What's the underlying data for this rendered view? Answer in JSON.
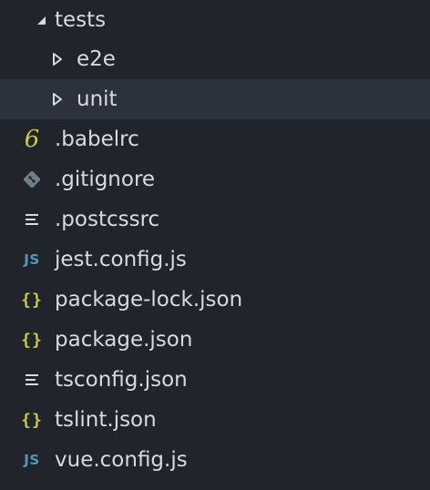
{
  "tree": [
    {
      "label": "tests",
      "icon": "caret-down-icon",
      "kind": "folder-open"
    },
    {
      "label": "e2e",
      "icon": "caret-right-icon",
      "kind": "folder-closed"
    },
    {
      "label": "unit",
      "icon": "caret-right-icon",
      "kind": "folder-closed",
      "hovered": true
    },
    {
      "label": ".babelrc",
      "icon": "babel-icon",
      "glyph": "6"
    },
    {
      "label": ".gitignore",
      "icon": "git-icon"
    },
    {
      "label": ".postcssrc",
      "icon": "lines-icon"
    },
    {
      "label": "jest.config.js",
      "icon": "js-icon",
      "glyph": "JS"
    },
    {
      "label": "package-lock.json",
      "icon": "json-icon",
      "glyph": "{}"
    },
    {
      "label": "package.json",
      "icon": "json-icon",
      "glyph": "{}"
    },
    {
      "label": "tsconfig.json",
      "icon": "lines-icon"
    },
    {
      "label": "tslint.json",
      "icon": "json-icon",
      "glyph": "{}"
    },
    {
      "label": "vue.config.js",
      "icon": "js-icon",
      "glyph": "JS"
    }
  ],
  "colors": {
    "background": "#21252b",
    "hover_background": "#2c313a",
    "text": "#d7dae0",
    "caret": "#d7dae0",
    "js_icon": "#519aba",
    "json_icon": "#cbcb41",
    "babel_icon": "#cbcb41",
    "git_icon": "#6d8086",
    "lines_icon": "#d7dae0"
  }
}
